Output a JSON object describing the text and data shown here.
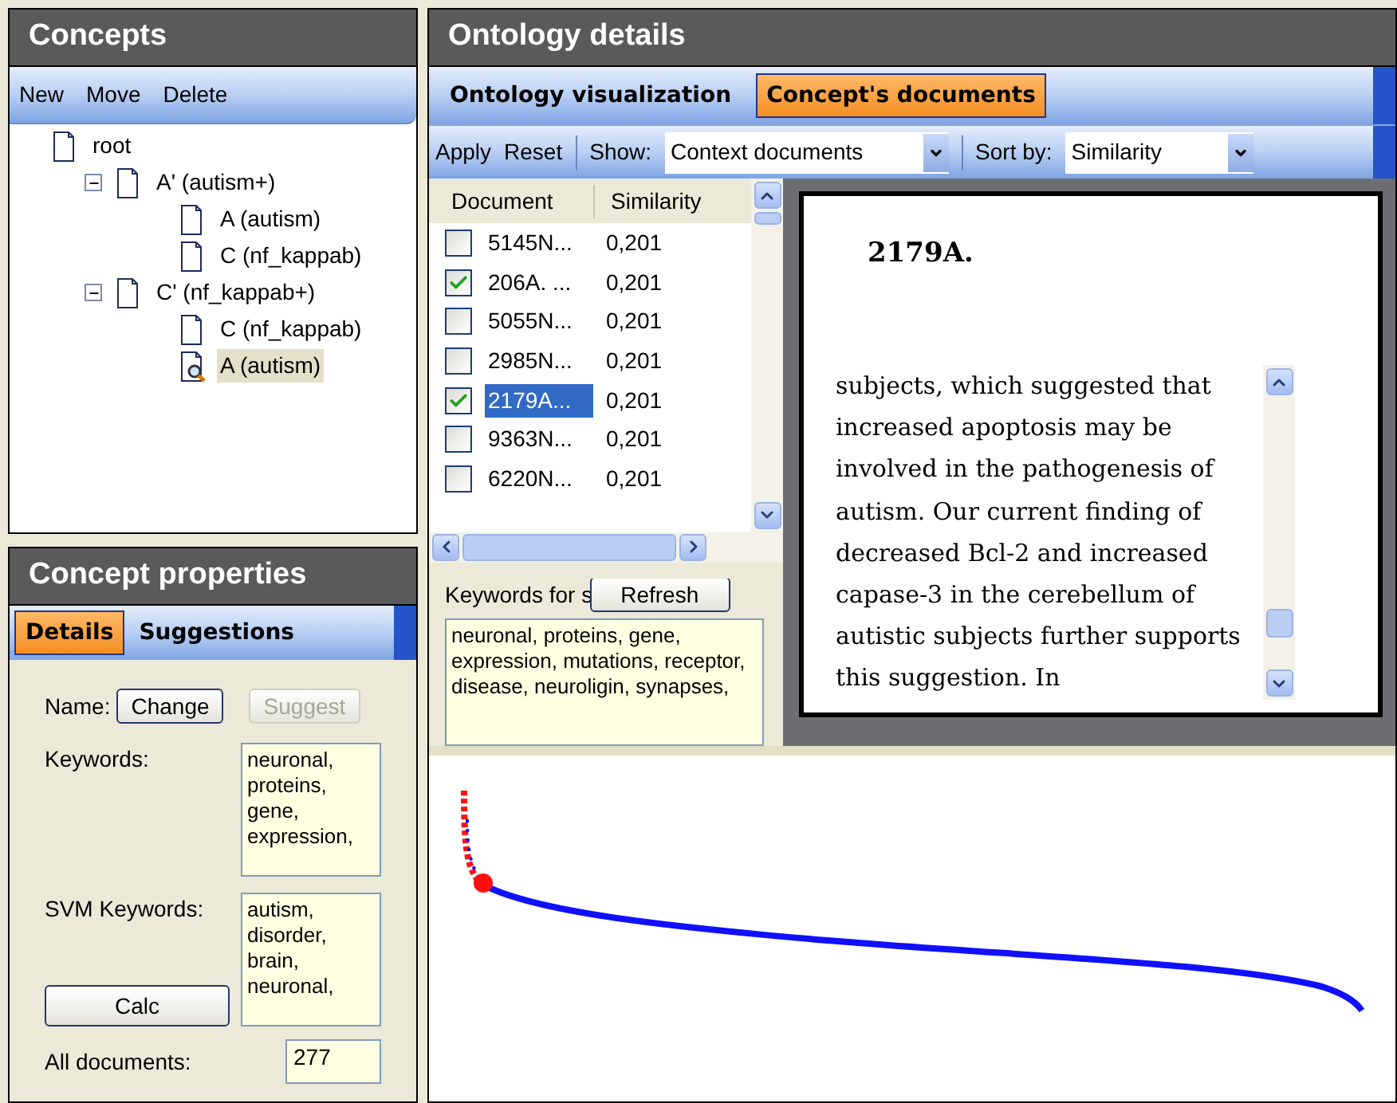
{
  "concepts": {
    "title": "Concepts",
    "toolbar": [
      "New",
      "Move",
      "Delete"
    ],
    "tree": [
      {
        "label": "root",
        "selected": false,
        "children": [
          {
            "label": "A' (autism+)",
            "selected": false,
            "expanded": true,
            "children": [
              {
                "label": "A (autism)",
                "selected": false
              },
              {
                "label": "C (nf_kappab)",
                "selected": false
              }
            ]
          },
          {
            "label": "C' (nf_kappab+)",
            "selected": false,
            "expanded": true,
            "children": [
              {
                "label": "C (nf_kappab)",
                "selected": false
              },
              {
                "label": "A (autism)",
                "selected": true
              }
            ]
          }
        ]
      }
    ]
  },
  "properties": {
    "title": "Concept properties",
    "tabs": [
      {
        "label": "Details",
        "selected": true
      },
      {
        "label": "Suggestions",
        "selected": false
      }
    ],
    "name_label": "Name:",
    "change_button": "Change",
    "suggest_button": {
      "label": "Suggest",
      "disabled": true
    },
    "keywords_label": "Keywords:",
    "keywords": "neuronal, proteins, gene, expression,",
    "svm_label": "SVM Keywords:",
    "svm_keywords": "autism, disorder, brain, neuronal,",
    "calc_button": "Calc",
    "all_documents_label": "All documents:",
    "all_documents": "277"
  },
  "details": {
    "title": "Ontology details",
    "tabs": [
      {
        "label": "Ontology visualization",
        "selected": false
      },
      {
        "label": "Concept's documents",
        "selected": true
      }
    ],
    "toolbar": {
      "apply": "Apply",
      "reset": "Reset",
      "show_label": "Show:",
      "show_value": "Context documents",
      "sort_label": "Sort by:",
      "sort_value": "Similarity"
    },
    "columns": [
      "Document",
      "Similarity"
    ],
    "rows": [
      {
        "document": "5145N...",
        "similarity": "0,201",
        "checked": false,
        "selected": false
      },
      {
        "document": "206A. ...",
        "similarity": "0,201",
        "checked": true,
        "selected": false
      },
      {
        "document": "5055N...",
        "similarity": "0,201",
        "checked": false,
        "selected": false
      },
      {
        "document": "2985N...",
        "similarity": "0,201",
        "checked": false,
        "selected": false
      },
      {
        "document": "2179A...",
        "similarity": "0,201",
        "checked": true,
        "selected": true
      },
      {
        "document": "9363N...",
        "similarity": "0,201",
        "checked": false,
        "selected": false
      },
      {
        "document": "6220N...",
        "similarity": "0,201",
        "checked": false,
        "selected": false
      }
    ],
    "keywords_label": "Keywords for s",
    "refresh_button": "Refresh",
    "keywords": "neuronal, proteins, gene, expression, mutations, receptor, disease, neuroligin, synapses,",
    "document": {
      "title": "2179A.",
      "text": "subjects, which suggested that increased apoptosis may be involved in the pathogenesis of autism. Our current finding of decreased Bcl-2 and increased capase-3 in the cerebellum of autistic subjects further supports this suggestion. In"
    }
  }
}
